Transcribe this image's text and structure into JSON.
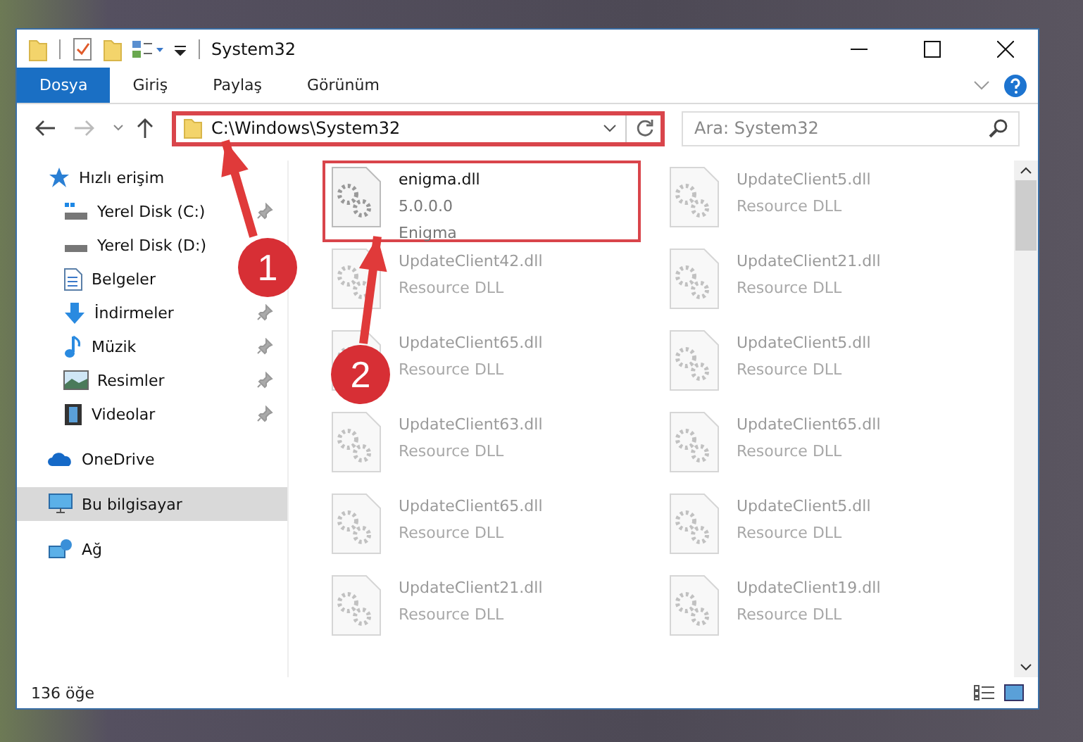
{
  "window": {
    "title": "System32"
  },
  "ribbon_tabs": [
    {
      "label": "Dosya",
      "selected": true
    },
    {
      "label": "Giriş",
      "selected": false
    },
    {
      "label": "Paylaş",
      "selected": false
    },
    {
      "label": "Görünüm",
      "selected": false
    }
  ],
  "address_bar": {
    "path": "C:\\Windows\\System32",
    "highlighted": true
  },
  "search": {
    "placeholder": "Ara: System32"
  },
  "sidebar": {
    "items": [
      {
        "label": "Hızlı erişim",
        "selected": false,
        "children": [
          {
            "label": "Yerel Disk (C:)",
            "pinned": true
          },
          {
            "label": "Yerel Disk (D:)",
            "pinned": false
          },
          {
            "label": "Belgeler",
            "pinned": false
          },
          {
            "label": "İndirmeler",
            "pinned": true
          },
          {
            "label": "Müzik",
            "pinned": true
          },
          {
            "label": "Resimler",
            "pinned": true
          },
          {
            "label": "Videolar",
            "pinned": true
          }
        ]
      },
      {
        "label": "OneDrive",
        "selected": false
      },
      {
        "label": "Bu bilgisayar",
        "selected": true
      },
      {
        "label": "Ağ",
        "selected": false
      }
    ]
  },
  "files": [
    {
      "name": "enigma.dll",
      "lines": [
        "5.0.0.0",
        "Enigma"
      ],
      "highlighted": true,
      "faded": false
    },
    {
      "name": "UpdateClient5.dll",
      "lines": [
        "Resource DLL"
      ],
      "highlighted": false,
      "faded": true
    },
    {
      "name": "UpdateClient42.dll",
      "lines": [
        "Resource DLL"
      ],
      "highlighted": false,
      "faded": true
    },
    {
      "name": "UpdateClient21.dll",
      "lines": [
        "Resource DLL"
      ],
      "highlighted": false,
      "faded": true
    },
    {
      "name": "UpdateClient65.dll",
      "lines": [
        "Resource DLL"
      ],
      "highlighted": false,
      "faded": true
    },
    {
      "name": "UpdateClient5.dll",
      "lines": [
        "Resource DLL"
      ],
      "highlighted": false,
      "faded": true
    },
    {
      "name": "UpdateClient63.dll",
      "lines": [
        "Resource DLL"
      ],
      "highlighted": false,
      "faded": true
    },
    {
      "name": "UpdateClient65.dll",
      "lines": [
        "Resource DLL"
      ],
      "highlighted": false,
      "faded": true
    },
    {
      "name": "UpdateClient65.dll",
      "lines": [
        "Resource DLL"
      ],
      "highlighted": false,
      "faded": true
    },
    {
      "name": "UpdateClient5.dll",
      "lines": [
        "Resource DLL"
      ],
      "highlighted": false,
      "faded": true
    },
    {
      "name": "UpdateClient21.dll",
      "lines": [
        "Resource DLL"
      ],
      "highlighted": false,
      "faded": true
    },
    {
      "name": "UpdateClient19.dll",
      "lines": [
        "Resource DLL"
      ],
      "highlighted": false,
      "faded": true
    }
  ],
  "status_bar": {
    "count": "136 öğe"
  },
  "annotations": [
    {
      "number": "1"
    },
    {
      "number": "2"
    }
  ]
}
